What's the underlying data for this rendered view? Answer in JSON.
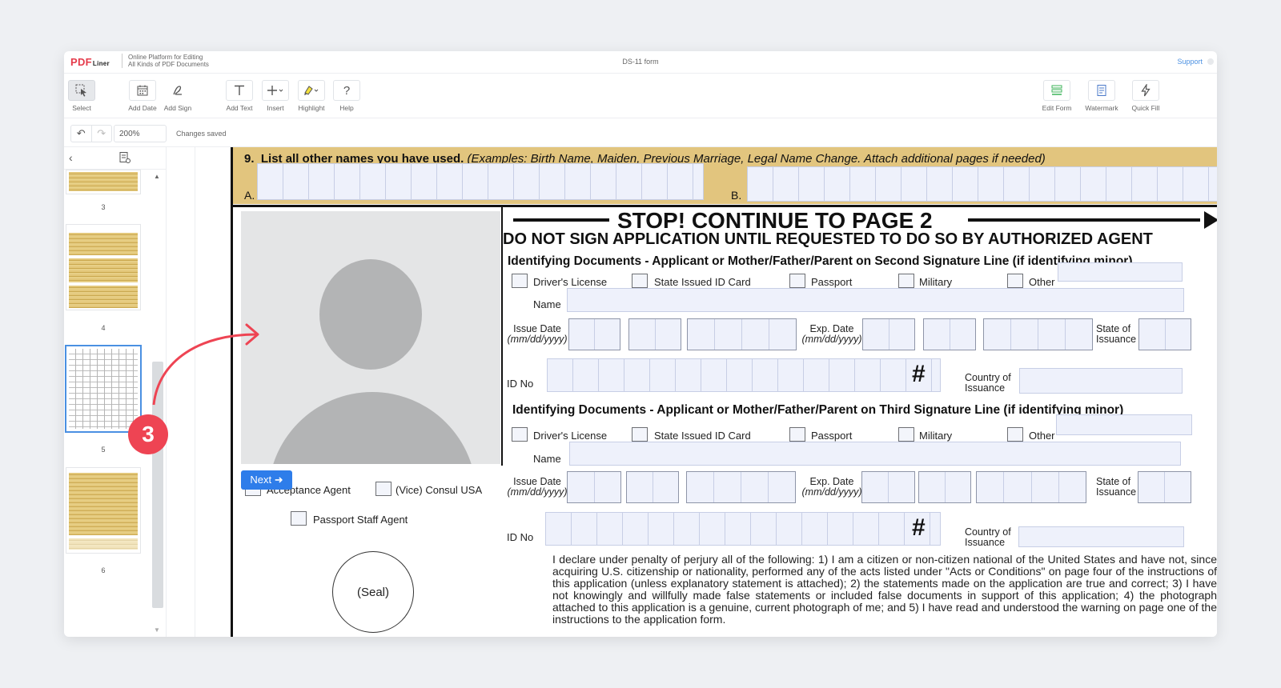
{
  "app": {
    "logo_main": "PDF",
    "logo_sub": "Liner",
    "tagline_line1": "Online Platform for Editing",
    "tagline_line2": "All Kinds of PDF Documents",
    "doc_title": "DS-11 form",
    "support": "Support"
  },
  "toolbar": {
    "select": "Select",
    "add_date": "Add Date",
    "add_sign": "Add Sign",
    "add_text": "Add Text",
    "insert": "Insert",
    "highlight": "Highlight",
    "help": "Help",
    "edit_form": "Edit Form",
    "watermark": "Watermark",
    "quick_fill": "Quick Fill"
  },
  "subbar": {
    "zoom": "200%",
    "status": "Changes saved"
  },
  "sidebar": {
    "pages": [
      "3",
      "4",
      "5",
      "6"
    ],
    "selected_page": "5"
  },
  "form": {
    "sec9_number": "9.",
    "sec9_title": "List all other names you have used.",
    "sec9_examples": "(Examples: Birth Name, Maiden, Previous Marriage, Legal Name Change.  Attach additional  pages if needed)",
    "sec9_a": "A.",
    "sec9_b": "B.",
    "stop_text": "STOP! CONTINUE TO PAGE 2",
    "donot_text": "DO NOT SIGN APPLICATION UNTIL REQUESTED TO DO SO BY AUTHORIZED AGENT",
    "id_title_second": "Identifying Documents - Applicant or Mother/Father/Parent on Second Signature Line (if identifying minor)",
    "id_title_third": "Identifying Documents - Applicant or Mother/Father/Parent on Third Signature Line (if identifying minor)",
    "doc_types": [
      "Driver's License",
      "State Issued ID Card",
      "Passport",
      "Military",
      "Other"
    ],
    "name_label": "Name",
    "issue_date_label": "Issue Date",
    "exp_date_label": "Exp. Date",
    "date_format": "(mm/dd/yyyy)",
    "state_label_1": "State of",
    "state_label_2": "Issuance",
    "id_no_label": "ID No",
    "hash": "#",
    "country_label_1": "Country of",
    "country_label_2": "Issuance",
    "acceptance_agent": "Acceptance Agent",
    "vice_consul": "(Vice) Consul USA",
    "passport_staff": "Passport Staff Agent",
    "seal": "(Seal)",
    "declaration": "I declare under penalty of perjury all of the following: 1) I am a citizen or non-citizen national of the United States and have not, since acquiring U.S. citizenship or nationality, performed any of the acts listed under \"Acts or Conditions\" on page four of the instructions of this application (unless explanatory statement is attached); 2) the statements made on the application are true and correct; 3) I have not knowingly and willfully made false statements or included false documents in support of this application; 4) the photograph attached to this application is a genuine, current photograph of me; and 5) I have read and understood the warning on page one of the instructions to the application form."
  },
  "tour": {
    "next_label": "Next ➜",
    "step": "3"
  },
  "colors": {
    "accent": "#2e7dea",
    "badge": "#ee4453",
    "section_fill": "#e2c57e"
  }
}
